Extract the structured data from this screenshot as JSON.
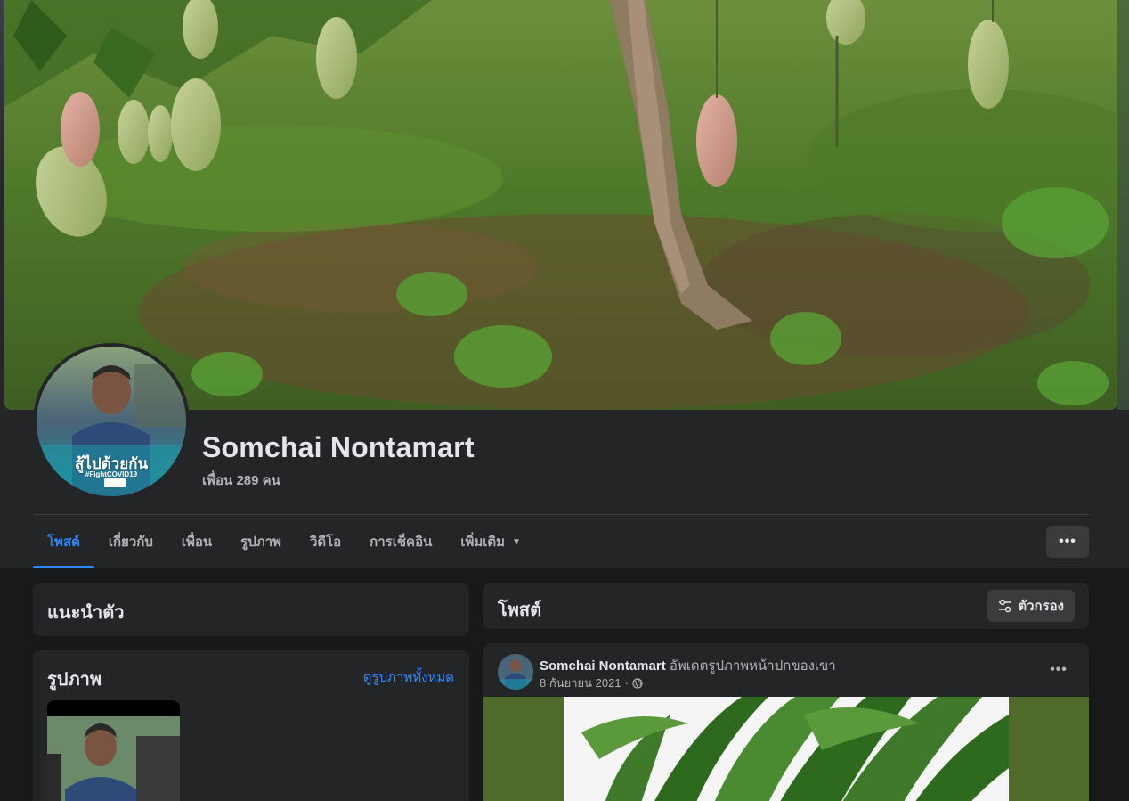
{
  "profile": {
    "name": "Somchai Nontamart",
    "friends": "เพื่อน 289 คน",
    "avatar_caption": "สู้ไปด้วยกัน",
    "avatar_tag": "#FightCOVID19"
  },
  "tabs": [
    {
      "label": "โพสต์",
      "active": true
    },
    {
      "label": "เกี่ยวกับ"
    },
    {
      "label": "เพื่อน"
    },
    {
      "label": "รูปภาพ"
    },
    {
      "label": "วิดีโอ"
    },
    {
      "label": "การเช็คอิน"
    },
    {
      "label": "เพิ่มเติม"
    }
  ],
  "more_button": "•••",
  "intro": {
    "title": "แนะนำตัว"
  },
  "photos": {
    "title": "รูปภาพ",
    "see_all": "ดูรูปภาพทั้งหมด"
  },
  "posts": {
    "title": "โพสต์",
    "filter_label": "ตัวกรอง"
  },
  "post": {
    "author": "Somchai Nontamart",
    "action": "อัพเดตรูปภาพหน้าปกของเขา",
    "date": "8 กันยายน 2021",
    "separator": "·",
    "more": "•••"
  },
  "colors": {
    "accent": "#2d88ff",
    "background": "#18191a",
    "card": "#242526"
  },
  "icons": [
    "globe-icon",
    "filter-icon",
    "caret-down-icon",
    "more-icon"
  ]
}
